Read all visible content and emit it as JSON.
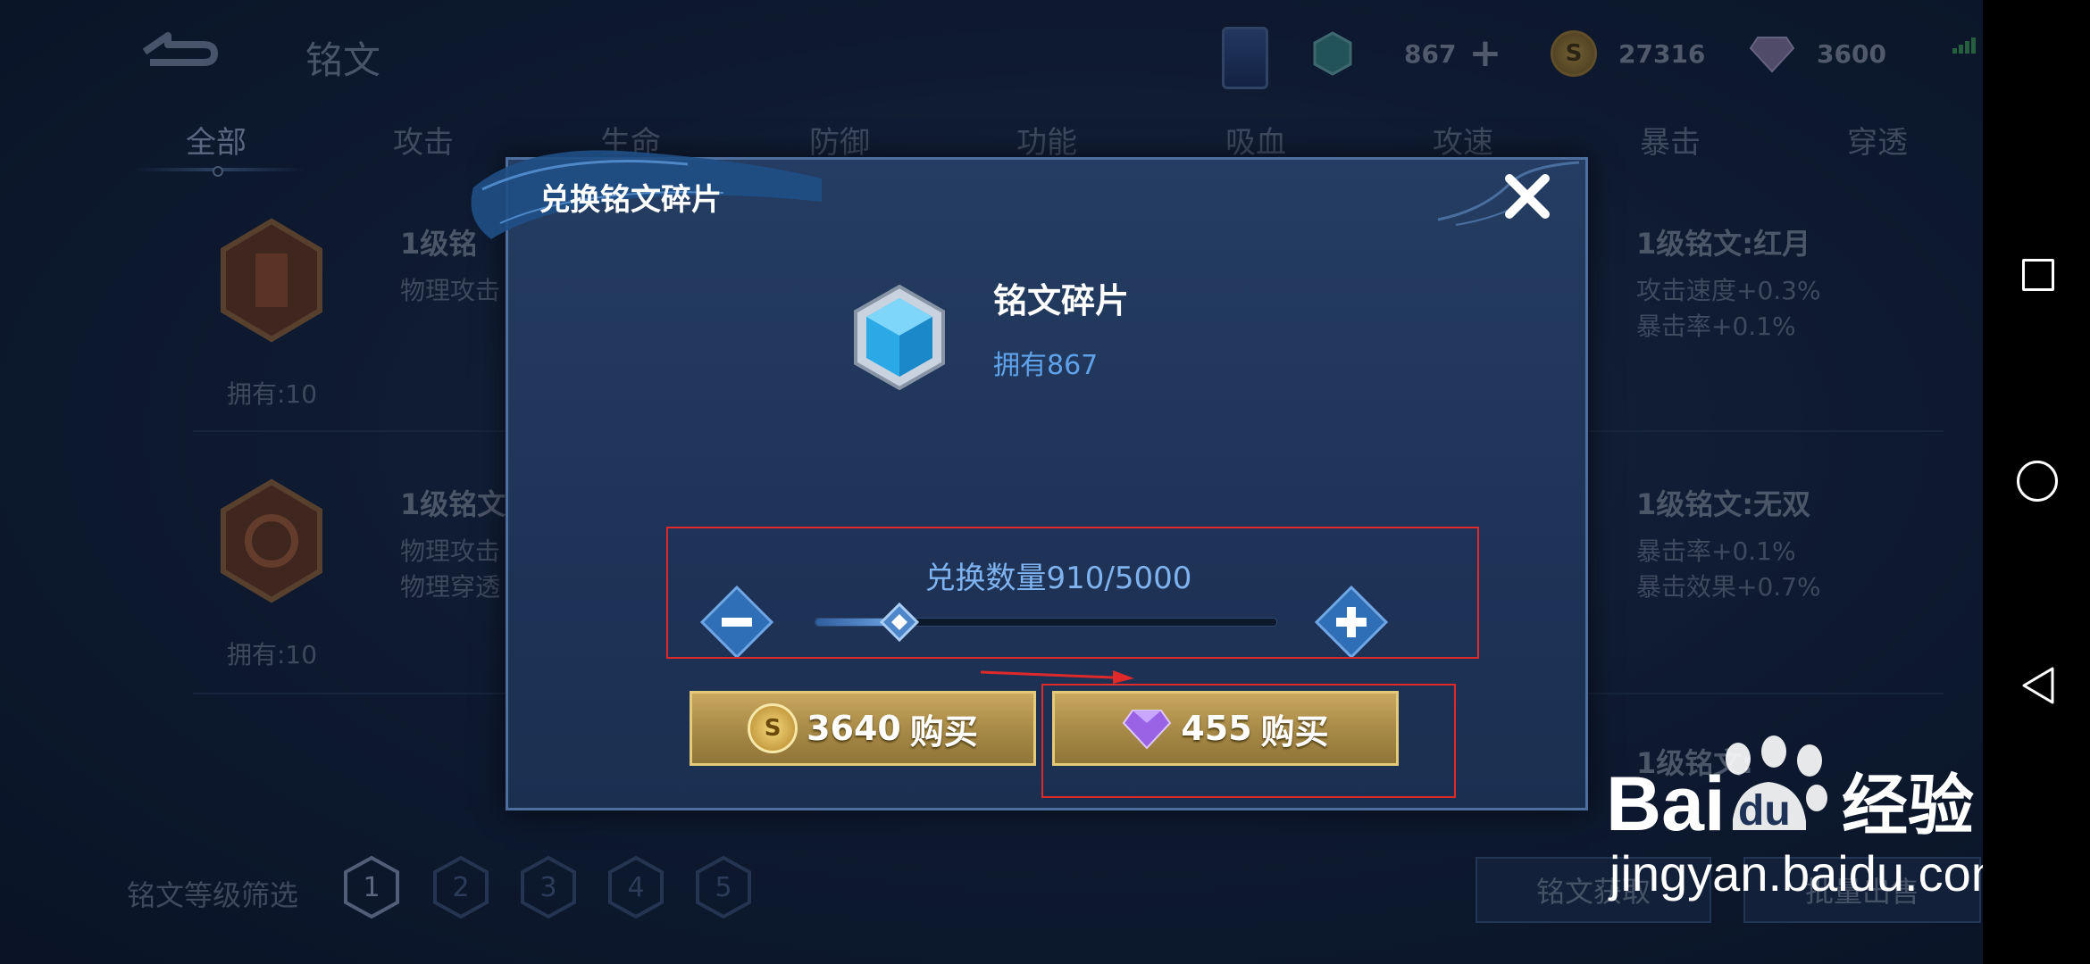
{
  "header": {
    "title": "铭文",
    "fragments_count": "867",
    "gold_count": "27316",
    "diamond_count": "3600"
  },
  "tabs": [
    "全部",
    "攻击",
    "生命",
    "防御",
    "功能",
    "吸血",
    "攻速",
    "暴击",
    "穿透"
  ],
  "active_tab": "全部",
  "runes_left": [
    {
      "name": "1级铭",
      "stats": [
        "物理攻击"
      ],
      "owned": "拥有:10"
    },
    {
      "name": "1级铭文",
      "stats": [
        "物理攻击",
        "物理穿透"
      ],
      "owned": "拥有:10"
    }
  ],
  "runes_right": [
    {
      "name": "1级铭文:红月",
      "stats": [
        "攻击速度+0.3%",
        "暴击率+0.1%"
      ]
    },
    {
      "name": "1级铭文:无双",
      "stats": [
        "暴击率+0.1%",
        "暴击效果+0.7%"
      ]
    },
    {
      "name": "1级铭文:",
      "stats": []
    }
  ],
  "filter": {
    "label": "铭文等级筛选",
    "levels": [
      "1",
      "2",
      "3",
      "4",
      "5"
    ],
    "selected": "1"
  },
  "bottom_buttons": {
    "left": "铭文获取",
    "right": "批量出售"
  },
  "dialog": {
    "title": "兑换铭文碎片",
    "item_name": "铭文碎片",
    "item_owned": "拥有867",
    "quantity_label": "兑换数量910/5000",
    "quantity_fraction": 0.182,
    "gold_price": "3640",
    "diamond_price": "455",
    "buy_label": "购买"
  },
  "colors": {
    "accent_blue": "#5fa2ea",
    "annotation_red": "#e02a2a",
    "button_gold": "#c9a85e"
  },
  "watermark": {
    "brand": "Bai",
    "brand_du": "du",
    "brand_cn": "经验",
    "url": "jingyan.baidu.com"
  }
}
